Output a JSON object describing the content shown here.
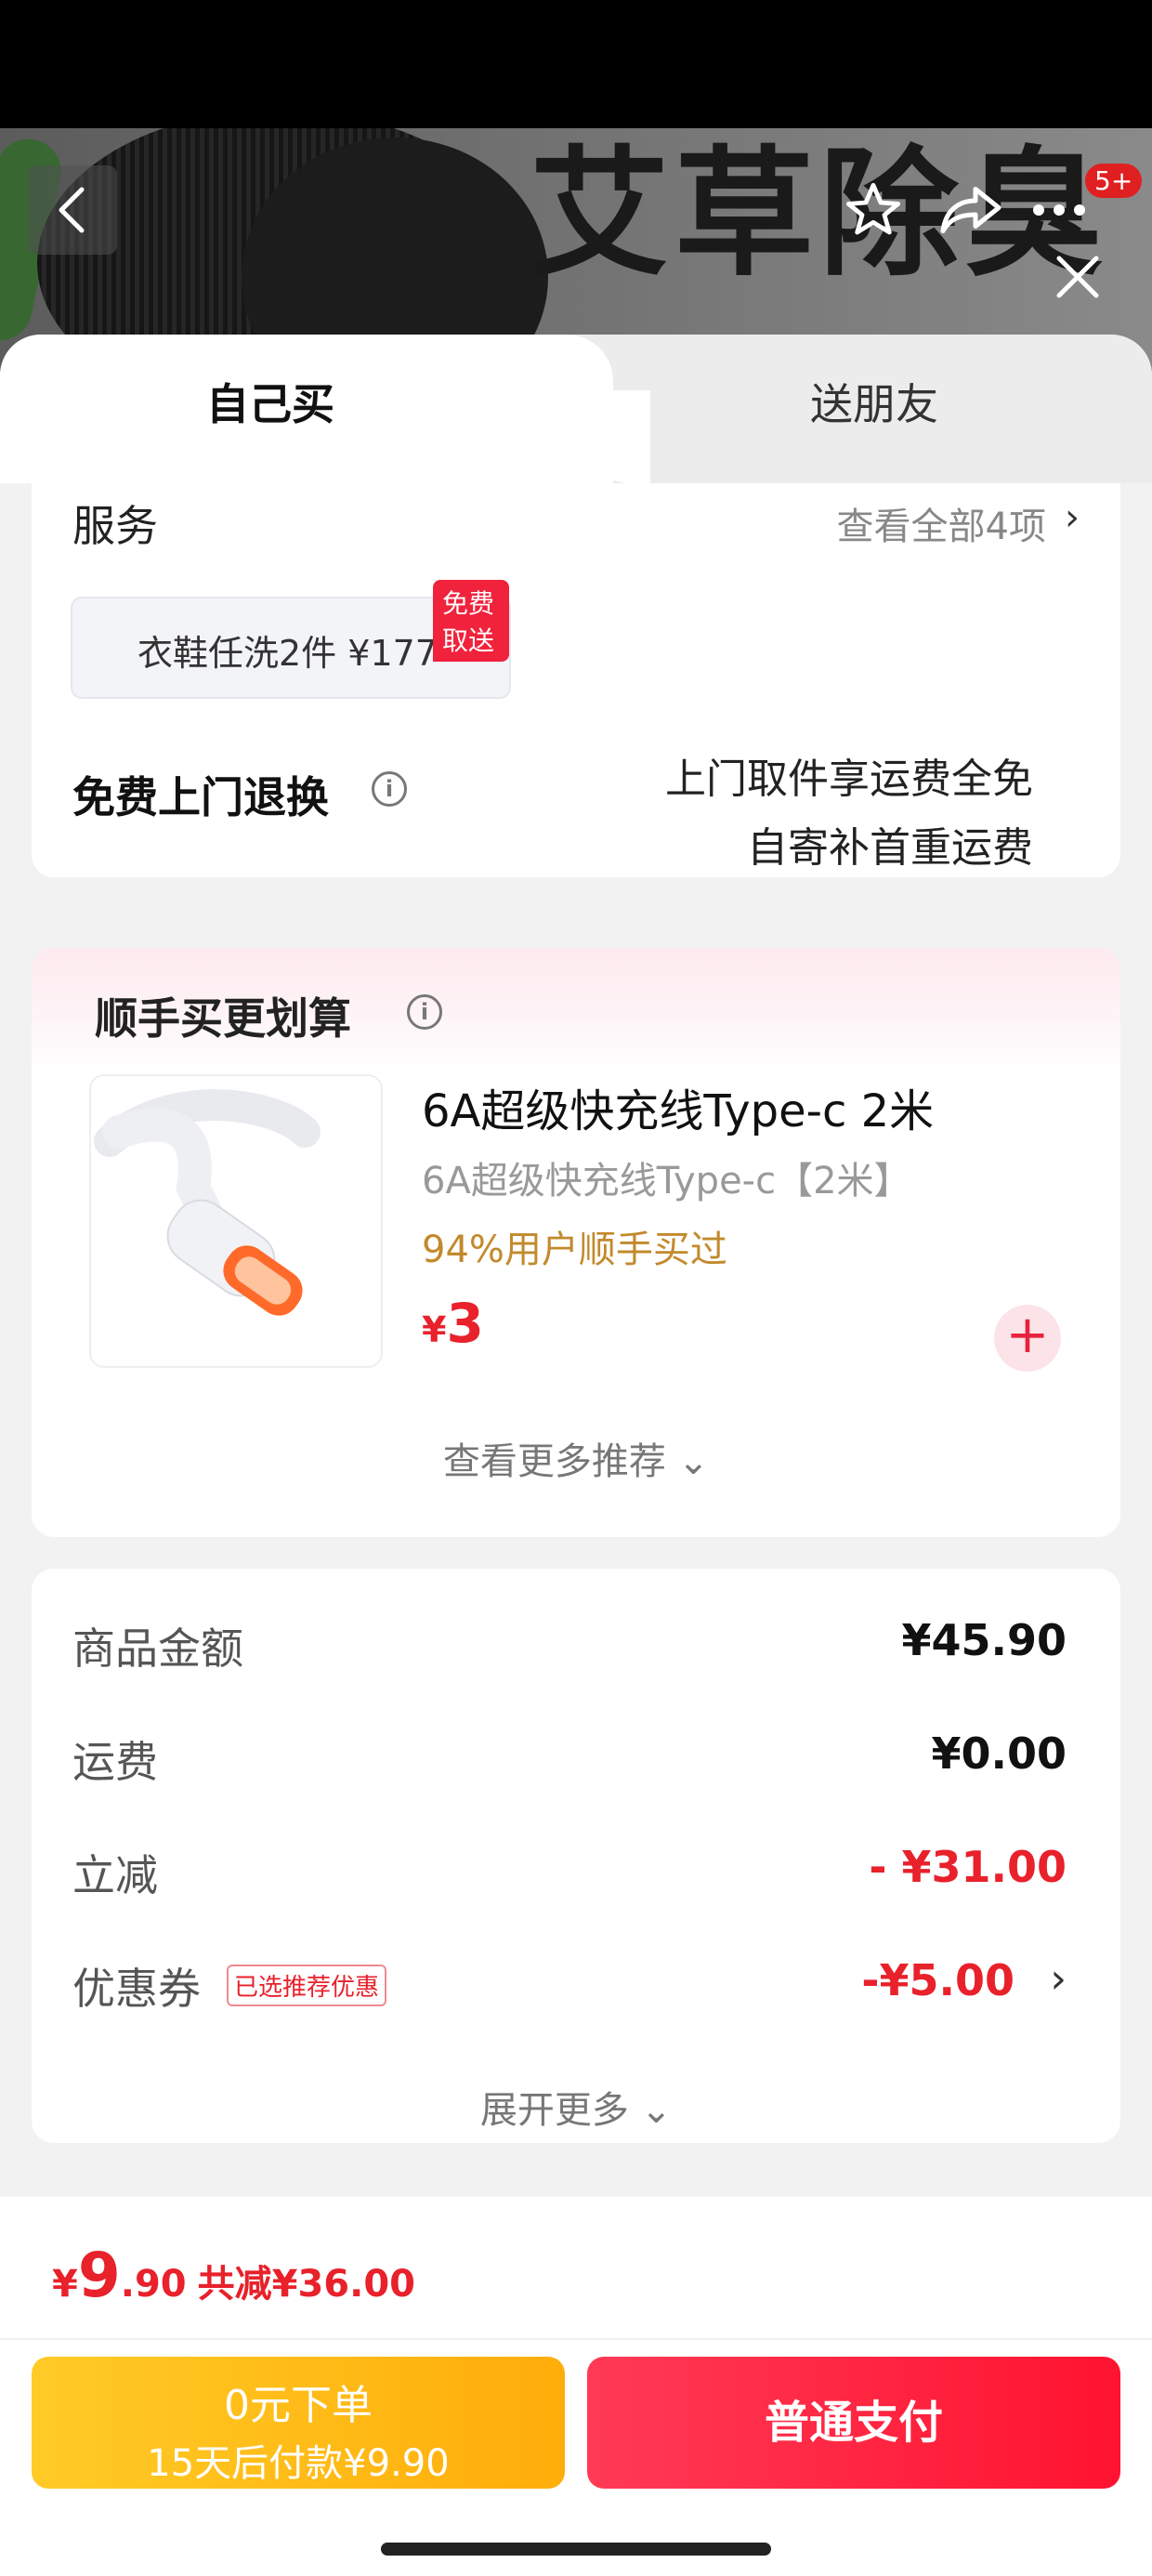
{
  "header": {
    "brand_text": "艾草除臭",
    "cart_count": "5+",
    "icons": [
      "back-icon",
      "star-icon",
      "share-icon",
      "more-icon",
      "close-icon"
    ]
  },
  "tabs": {
    "self": "自己买",
    "gift": "送朋友"
  },
  "service": {
    "title": "服务",
    "view_all": "查看全部4项",
    "wash_label": "衣鞋任洗2件",
    "wash_price": "¥177",
    "free_pickup_badge": "免费取送",
    "return_title": "免费上门退换",
    "return_line1": "上门取件享运费全免",
    "return_line2": "自寄补首重运费"
  },
  "recommend": {
    "title": "顺手买更划算",
    "product_name": "6A超级快充线Type-c 2米",
    "product_spec": "6A超级快充线Type-c【2米】",
    "product_stat": "94%用户顺手买过",
    "currency": "¥",
    "price": "3",
    "more": "查看更多推荐"
  },
  "price_detail": {
    "goods_label": "商品金额",
    "goods_value": "¥45.90",
    "shipping_label": "运费",
    "shipping_value": "¥0.00",
    "discount_label": "立减",
    "discount_value": "- ¥31.00",
    "coupon_label": "优惠券",
    "coupon_tag": "已选推荐优惠",
    "coupon_value": "-¥5.00",
    "expand": "展开更多"
  },
  "bottom": {
    "currency": "¥",
    "total_int": "9",
    "total_dec": ".90",
    "saved": "共减¥36.00",
    "zero_pay_line1": "0元下单",
    "zero_pay_line2": "15天后付款¥9.90",
    "pay_button": "普通支付"
  },
  "colors": {
    "accent_red": "#e8212b",
    "gold": "#ffb80f",
    "pay_red": "#ff2040"
  }
}
